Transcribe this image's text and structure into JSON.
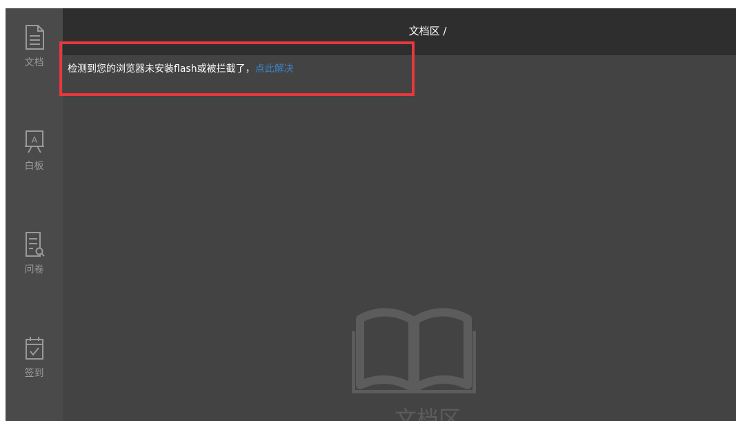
{
  "sidebar": {
    "items": [
      {
        "label": "文档",
        "icon": "document-icon"
      },
      {
        "label": "白板",
        "icon": "whiteboard-icon"
      },
      {
        "label": "问卷",
        "icon": "questionnaire-icon"
      },
      {
        "label": "签到",
        "icon": "checkin-calendar-icon"
      }
    ]
  },
  "header": {
    "title": "文档区 /"
  },
  "alert": {
    "message": "检测到您的浏览器未安装flash或被拦截了，",
    "link_text": "点此解决"
  },
  "placeholder": {
    "icon": "open-book-icon",
    "label": "文档区"
  },
  "colors": {
    "sidebar_bg": "#4a4a4a",
    "main_bg": "#434343",
    "topbar_bg": "#2e2e2e",
    "link": "#3e82c6",
    "highlight_border": "#e8383c"
  }
}
